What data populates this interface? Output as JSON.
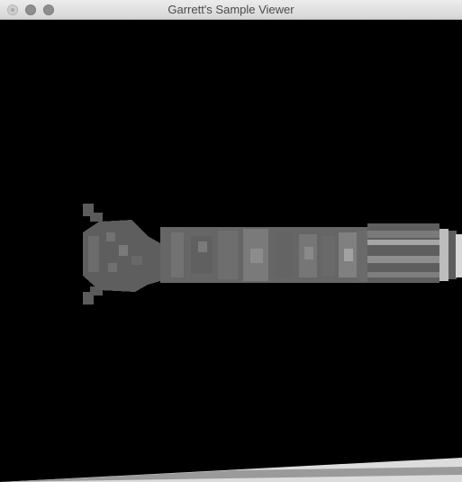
{
  "window": {
    "title": "Garrett's Sample Viewer",
    "controls": [
      "close-button",
      "minimize-button",
      "zoom-button"
    ]
  },
  "viewport": {
    "background": "#000000",
    "content": "pixelated-grayscale-render"
  },
  "colors": {
    "titlebar_text": "#4a4a4a",
    "object_gray": "#6e6e6e",
    "object_highlight": "#bdbdbd",
    "floor_plane": "#e6e6e6"
  }
}
